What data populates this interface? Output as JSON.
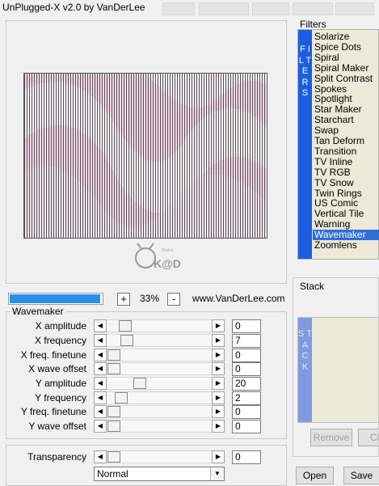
{
  "window": {
    "title": "UnPlugged-X v2.0 by VanDerLee"
  },
  "preview": {
    "logo_text": "K@D",
    "logo_small": "Pedro"
  },
  "zoom": {
    "minus_label": "-",
    "plus_label": "+",
    "value": "33%",
    "progress": 0.98
  },
  "website": "www.VanDerLee.com",
  "wavemaker": {
    "title": "Wavemaker",
    "params": [
      {
        "label": "X amplitude",
        "value": "0",
        "position": 0.12
      },
      {
        "label": "X frequency",
        "value": "7",
        "position": 0.14
      },
      {
        "label": "X freq. finetune",
        "value": "0",
        "position": 0.0
      },
      {
        "label": "X wave offset",
        "value": "0",
        "position": 0.0
      },
      {
        "label": "Y amplitude",
        "value": "20",
        "position": 0.28
      },
      {
        "label": "Y frequency",
        "value": "2",
        "position": 0.08
      },
      {
        "label": "Y freq. finetune",
        "value": "0",
        "position": 0.0
      },
      {
        "label": "Y wave offset",
        "value": "0",
        "position": 0.0
      }
    ],
    "transparency": {
      "label": "Transparency",
      "value": "0",
      "position": 0.0
    },
    "blend_mode": "Normal"
  },
  "filters": {
    "title": "Filters",
    "side_label": "F I L T E R S",
    "items": [
      "Solarize",
      "Spice Dots",
      "Spiral",
      "Spiral Maker",
      "Split Contrast",
      "Spokes",
      "Spotlight",
      "Star Maker",
      "Starchart",
      "Swap",
      "Tan Deform",
      "Transition",
      "TV Inline",
      "TV RGB",
      "TV Snow",
      "Twin Rings",
      "US Comic",
      "Vertical Tile",
      "Warning",
      "Wavemaker",
      "Zoomlens"
    ],
    "selected": "Wavemaker"
  },
  "stack": {
    "title": "Stack",
    "side_label": "S T A C K",
    "remove_label": "Remove",
    "clear_label": "Cl"
  },
  "footer": {
    "open_label": "Open",
    "save_label": "Save"
  },
  "colors": {
    "accent": "#1b5fe0",
    "selection": "#2f6fd8",
    "progress": "#2b8fe8"
  }
}
